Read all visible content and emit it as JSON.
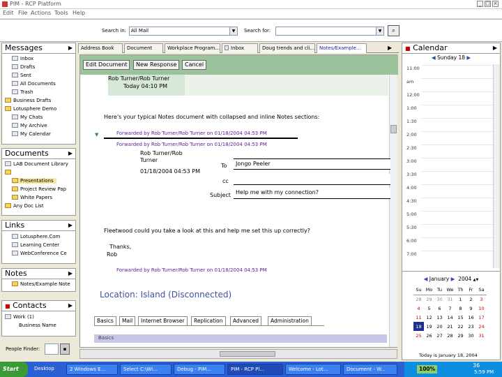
{
  "window": {
    "title": "PIM - RCP Platform"
  },
  "menu": [
    "Edit",
    "File",
    "Actions",
    "Tools",
    "Help"
  ],
  "search": {
    "search_in_label": "Search in:",
    "search_in_value": "All Mail",
    "search_for_label": "Search for:",
    "search_for_value": ""
  },
  "messages": {
    "title": "Messages",
    "items": [
      "Inbox",
      "Drafts",
      "Sent",
      "All Documents",
      "Trash",
      "Business Drafts",
      "Lotusphere Demo",
      "My Chats",
      "My Archive",
      "My Calendar"
    ]
  },
  "documents": {
    "title": "Documents",
    "items": [
      "LAB Document Library",
      "",
      "Presentations",
      "Project Review Pap",
      "White Papers",
      "Any Doc List"
    ]
  },
  "links": {
    "title": "Links",
    "items": [
      "Lotusphere.Com",
      "Learning Center",
      "WebConference Ce"
    ]
  },
  "notes": {
    "title": "Notes",
    "items": [
      "Notes/Example Note"
    ]
  },
  "contacts": {
    "title": "Contacts",
    "items": [
      "Work (1)",
      "Business Name"
    ]
  },
  "people_finder": {
    "label": "People Finder:"
  },
  "tabs": [
    "Address Book",
    "Document",
    "Workplace Program...",
    "Inbox",
    "Doug trends and cli...",
    "Notes/Example..."
  ],
  "doc": {
    "actions": [
      "Edit Document",
      "New Response",
      "Cancel"
    ],
    "header_author": "Rob Turner/Rob Turner",
    "header_time": "Today 04:10 PM",
    "intro": "Here's your typical Notes document with collapsed and inline Notes sections:",
    "link1": "Forwarded by Rob Turner/Rob Turner on 01/18/2004 04:53 PM",
    "link2": "Forwarded by Rob Turner/Rob Turner on 01/18/2004 04:53 PM",
    "inner_author_1": "Rob Turner/Rob",
    "inner_author_2": "Turner",
    "inner_date": "01/18/2004 04:53 PM",
    "to_label": "To",
    "to_value": "Jongo Peeler",
    "cc_label": "cc",
    "cc_value": "",
    "subject_label": "Subject",
    "subject_value": "Help me with my connection?",
    "body1": "Fleetwood could you take a look at this and help me set this up correctly?",
    "body2": "Thanks,",
    "body3": "Rob",
    "link3": "Forwarded by Rob Turner/Rob Turner on 01/18/2004 04:53 PM",
    "location": "Location: Island (Disconnected)",
    "bottom_tabs": [
      "Basics",
      "Mail",
      "Internet Browser",
      "Replication",
      "Advanced",
      "Administration"
    ],
    "basics": "Basics"
  },
  "calendar": {
    "title": "Calendar",
    "day": "Sunday 18",
    "hours": [
      "11:00",
      "am",
      "12:00",
      "1:00",
      "1:30",
      "2:00",
      "2:30",
      "3:00",
      "3:30",
      "4:00",
      "4:30",
      "5:00",
      "5:30",
      "6:00",
      "7:00"
    ],
    "month": "January",
    "year": "2004",
    "weekdays": [
      "Su",
      "Mo",
      "Tu",
      "We",
      "Th",
      "Fr",
      "Sa"
    ],
    "weeks": [
      [
        "28",
        "29",
        "30",
        "31",
        "1",
        "2",
        "3"
      ],
      [
        "4",
        "5",
        "6",
        "7",
        "8",
        "9",
        "10"
      ],
      [
        "11",
        "12",
        "13",
        "14",
        "15",
        "16",
        "17"
      ],
      [
        "18",
        "19",
        "20",
        "21",
        "22",
        "23",
        "24"
      ],
      [
        "25",
        "26",
        "27",
        "28",
        "29",
        "30",
        "31"
      ]
    ],
    "today_text": "Today is January 18, 2004"
  },
  "taskbar": {
    "start": "Start",
    "items": [
      "Desktop",
      "2 Windows E...",
      "Select C:\\Wi...",
      "Debug - PIM...",
      "PIM - RCP Pl...",
      "Welcome - Lot...",
      "Document - W..."
    ],
    "zoom": "100%",
    "time": "5:59 PM",
    "page_number": "36"
  },
  "colors": {
    "action_bar": "#9bc29b",
    "link": "#5a1a9a",
    "location": "#3f4fa0",
    "taskbar": "#2b5fd6"
  }
}
